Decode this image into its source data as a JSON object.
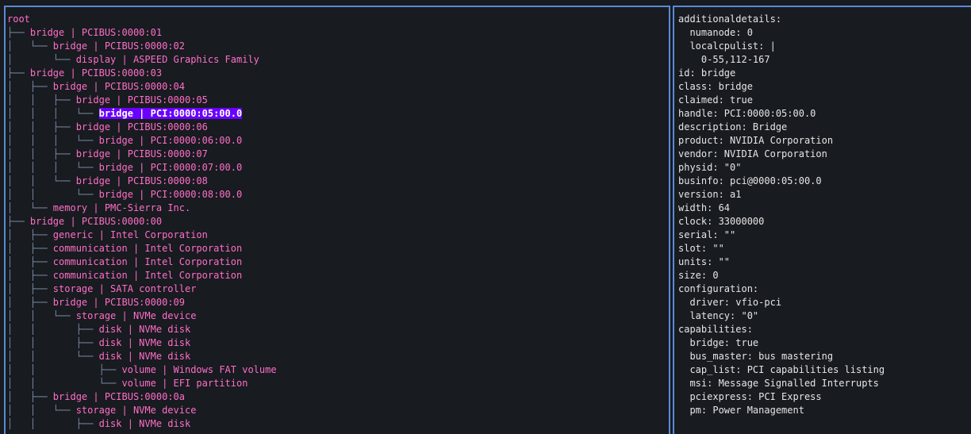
{
  "tree": {
    "rows": [
      {
        "prefix": "",
        "label": "root"
      },
      {
        "prefix": "├── ",
        "label": "bridge | PCIBUS:0000:01"
      },
      {
        "prefix": "│   └── ",
        "label": "bridge | PCIBUS:0000:02"
      },
      {
        "prefix": "│       └── ",
        "label": "display | ASPEED Graphics Family"
      },
      {
        "prefix": "├── ",
        "label": "bridge | PCIBUS:0000:03"
      },
      {
        "prefix": "│   ├── ",
        "label": "bridge | PCIBUS:0000:04"
      },
      {
        "prefix": "│   │   ├── ",
        "label": "bridge | PCIBUS:0000:05"
      },
      {
        "prefix": "│   │   │   └── ",
        "label": "bridge | PCI:0000:05:00.0",
        "selected": true
      },
      {
        "prefix": "│   │   ├── ",
        "label": "bridge | PCIBUS:0000:06"
      },
      {
        "prefix": "│   │   │   └── ",
        "label": "bridge | PCI:0000:06:00.0"
      },
      {
        "prefix": "│   │   ├── ",
        "label": "bridge | PCIBUS:0000:07"
      },
      {
        "prefix": "│   │   │   └── ",
        "label": "bridge | PCI:0000:07:00.0"
      },
      {
        "prefix": "│   │   └── ",
        "label": "bridge | PCIBUS:0000:08"
      },
      {
        "prefix": "│   │       └── ",
        "label": "bridge | PCI:0000:08:00.0"
      },
      {
        "prefix": "│   └── ",
        "label": "memory | PMC-Sierra Inc."
      },
      {
        "prefix": "├── ",
        "label": "bridge | PCIBUS:0000:00"
      },
      {
        "prefix": "│   ├── ",
        "label": "generic | Intel Corporation"
      },
      {
        "prefix": "│   ├── ",
        "label": "communication | Intel Corporation"
      },
      {
        "prefix": "│   ├── ",
        "label": "communication | Intel Corporation"
      },
      {
        "prefix": "│   ├── ",
        "label": "communication | Intel Corporation"
      },
      {
        "prefix": "│   ├── ",
        "label": "storage | SATA controller"
      },
      {
        "prefix": "│   ├── ",
        "label": "bridge | PCIBUS:0000:09"
      },
      {
        "prefix": "│   │   └── ",
        "label": "storage | NVMe device"
      },
      {
        "prefix": "│   │       ├── ",
        "label": "disk | NVMe disk"
      },
      {
        "prefix": "│   │       ├── ",
        "label": "disk | NVMe disk"
      },
      {
        "prefix": "│   │       └── ",
        "label": "disk | NVMe disk"
      },
      {
        "prefix": "│   │           ├── ",
        "label": "volume | Windows FAT volume"
      },
      {
        "prefix": "│   │           └── ",
        "label": "volume | EFI partition"
      },
      {
        "prefix": "│   ├── ",
        "label": "bridge | PCIBUS:0000:0a"
      },
      {
        "prefix": "│   │   └── ",
        "label": "storage | NVMe device"
      },
      {
        "prefix": "│   │       ├── ",
        "label": "disk | NVMe disk"
      }
    ]
  },
  "details": {
    "lines": [
      "additionaldetails:",
      "  numanode: 0",
      "  localcpulist: |",
      "    0-55,112-167",
      "id: bridge",
      "class: bridge",
      "claimed: true",
      "handle: PCI:0000:05:00.0",
      "description: Bridge",
      "product: NVIDIA Corporation",
      "vendor: NVIDIA Corporation",
      "physid: \"0\"",
      "businfo: pci@0000:05:00.0",
      "version: a1",
      "width: 64",
      "clock: 33000000",
      "serial: \"\"",
      "slot: \"\"",
      "units: \"\"",
      "size: 0",
      "configuration:",
      "  driver: vfio-pci",
      "  latency: \"0\"",
      "capabilities:",
      "  bridge: true",
      "  bus_master: bus mastering",
      "  cap_list: PCI capabilities listing",
      "  msi: Message Signalled Interrupts",
      "  pciexpress: PCI Express",
      "  pm: Power Management"
    ]
  },
  "colors": {
    "border": "#5a8ad6",
    "node": "#ff6ec7",
    "selected_bg": "#6a00ff",
    "background": "#181b20"
  }
}
